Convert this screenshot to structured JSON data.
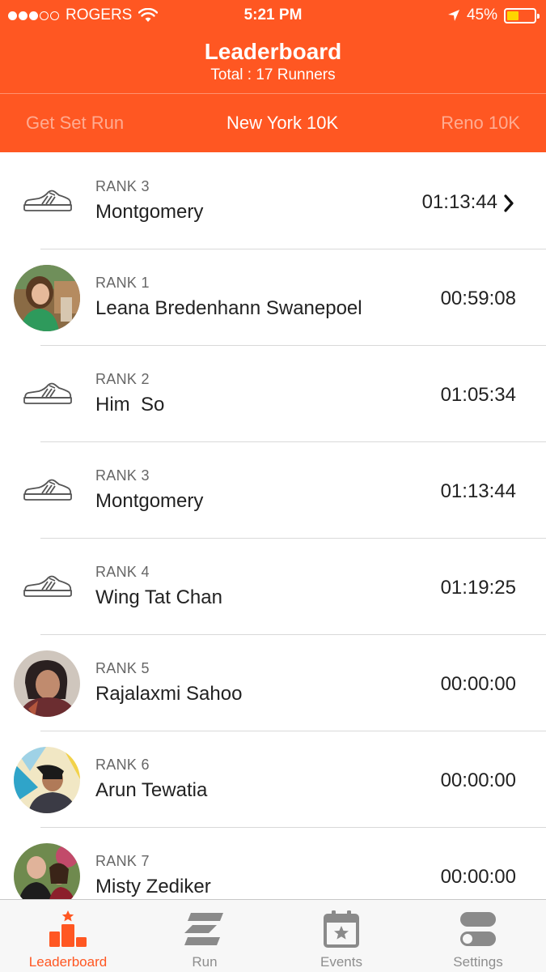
{
  "status_bar": {
    "carrier": "ROGERS",
    "time": "5:21 PM",
    "battery": "45%",
    "battery_level": 0.45,
    "signal_bars_filled": 3,
    "signal_bars_total": 5
  },
  "header": {
    "title": "Leaderboard",
    "subtitle": "Total : 17 Runners"
  },
  "event_tabs": [
    {
      "label": "Get Set Run",
      "active": false
    },
    {
      "label": "New York 10K",
      "active": true
    },
    {
      "label": "Reno 10K",
      "active": false
    }
  ],
  "rows": [
    {
      "rank": "RANK 3",
      "name": "Montgomery",
      "time": "01:13:44",
      "avatar": "shoe-icon",
      "highlight": true
    },
    {
      "rank": "RANK 1",
      "name": "Leana Bredenhann Swanepoel",
      "time": "00:59:08",
      "avatar": "photo"
    },
    {
      "rank": "RANK 2",
      "name": "Him  So",
      "time": "01:05:34",
      "avatar": "shoe-icon"
    },
    {
      "rank": "RANK 3",
      "name": "Montgomery",
      "time": "01:13:44",
      "avatar": "shoe-icon"
    },
    {
      "rank": "RANK 4",
      "name": "Wing Tat Chan",
      "time": "01:19:25",
      "avatar": "shoe-icon"
    },
    {
      "rank": "RANK 5",
      "name": "Rajalaxmi Sahoo",
      "time": "00:00:00",
      "avatar": "photo"
    },
    {
      "rank": "RANK 6",
      "name": "Arun Tewatia",
      "time": "00:00:00",
      "avatar": "photo"
    },
    {
      "rank": "RANK 7",
      "name": "Misty Zediker",
      "time": "00:00:00",
      "avatar": "photo"
    }
  ],
  "tabbar": [
    {
      "label": "Leaderboard",
      "icon": "podium-icon",
      "active": true
    },
    {
      "label": "Run",
      "icon": "run-logo-icon",
      "active": false
    },
    {
      "label": "Events",
      "icon": "calendar-star-icon",
      "active": false
    },
    {
      "label": "Settings",
      "icon": "toggles-icon",
      "active": false
    }
  ],
  "colors": {
    "brand": "#ff5722",
    "battery": "#ffd500",
    "tab_inactive": "#8e8e8e"
  }
}
